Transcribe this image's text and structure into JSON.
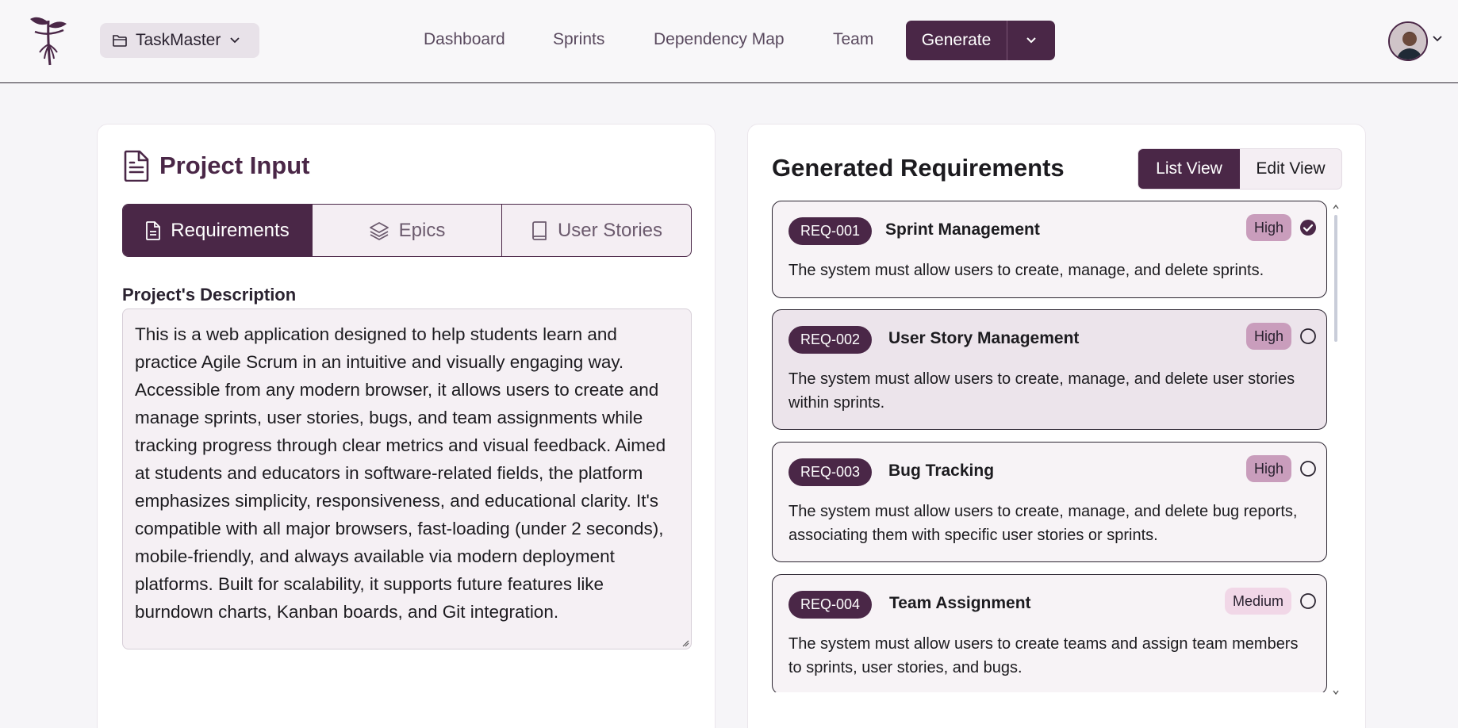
{
  "nav": {
    "project_name": "TaskMaster",
    "links": [
      "Dashboard",
      "Sprints",
      "Dependency Map",
      "Team"
    ],
    "generate_label": "Generate"
  },
  "project_input": {
    "title": "Project Input",
    "tabs": [
      {
        "label": "Requirements",
        "active": true
      },
      {
        "label": "Epics",
        "active": false
      },
      {
        "label": "User Stories",
        "active": false
      }
    ],
    "description_label": "Project's Description",
    "description_text": "This is a web application designed to help students learn and practice Agile Scrum in an intuitive and visually engaging way. Accessible from any modern browser, it allows users to create and manage sprints, user stories, bugs, and team assignments while tracking progress through clear metrics and visual feedback. Aimed at students and educators in software-related fields, the platform emphasizes simplicity, responsiveness, and educational clarity. It's compatible with all major browsers, fast-loading (under 2 seconds), mobile-friendly, and always available via modern deployment platforms. Built for scalability, it supports future features like burndown charts, Kanban boards, and Git integration."
  },
  "generated": {
    "title": "Generated Requirements",
    "view_list_label": "List View",
    "view_edit_label": "Edit View",
    "items": [
      {
        "id": "REQ-001",
        "name": "Sprint Management",
        "priority": "High",
        "checked": true,
        "description": "The system must allow users to create, manage, and delete sprints."
      },
      {
        "id": "REQ-002",
        "name": "User Story Management",
        "priority": "High",
        "checked": false,
        "description": "The system must allow users to create, manage, and delete user stories within sprints."
      },
      {
        "id": "REQ-003",
        "name": "Bug Tracking",
        "priority": "High",
        "checked": false,
        "description": "The system must allow users to create, manage, and delete bug reports, associating them with specific user stories or sprints."
      },
      {
        "id": "REQ-004",
        "name": "Team Assignment",
        "priority": "Medium",
        "checked": false,
        "description": "The system must allow users to create teams and assign team members to sprints, user stories, and bugs."
      }
    ]
  },
  "colors": {
    "brand": "#4a2747",
    "priority_high": "#c99dbc",
    "priority_medium": "#f1d7e7"
  }
}
